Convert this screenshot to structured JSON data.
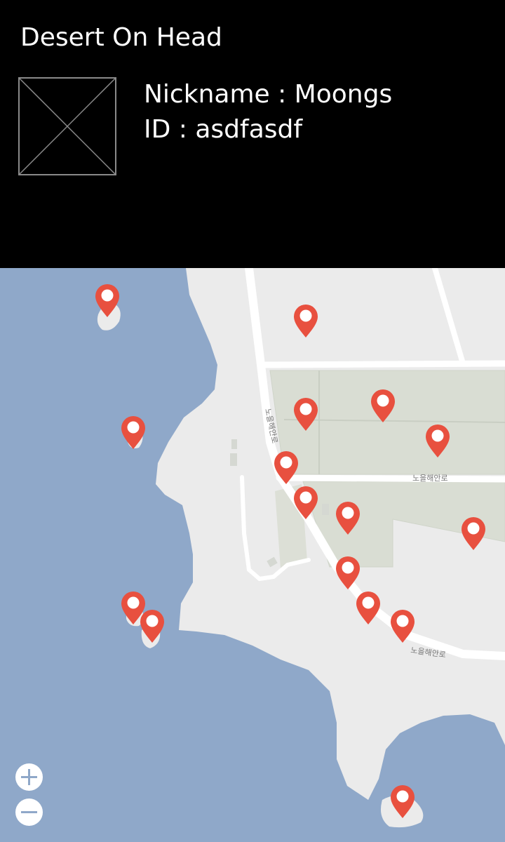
{
  "header": {
    "app_title": "Desert On Head",
    "nickname_text": "Nickname : Moongs",
    "id_text": "ID : asdfasdf"
  },
  "map": {
    "water_color": "#8fa8c9",
    "land_color": "#ebebeb",
    "park_color": "#d9ddd3",
    "road_color": "#ffffff",
    "pin_color": "#e8503f",
    "road_labels": [
      "노을해안로",
      "노을해안로",
      "노을해안로"
    ],
    "pin_count": 17,
    "zoom": {
      "in_icon": "plus-icon",
      "out_icon": "minus-icon"
    }
  }
}
